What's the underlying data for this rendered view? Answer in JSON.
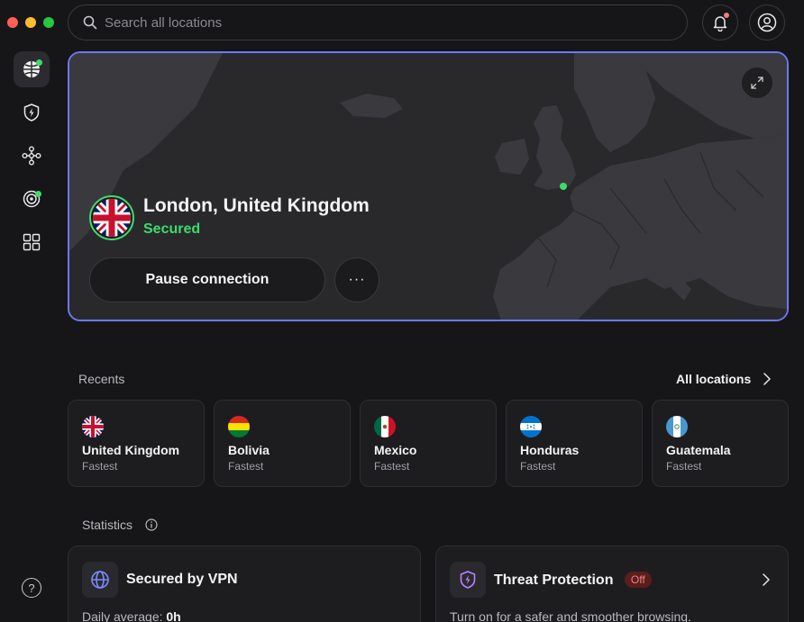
{
  "search": {
    "placeholder": "Search all locations"
  },
  "colors": {
    "accent": "#6a79f2",
    "connected": "#3ddc6a",
    "notification": "#f07f7f",
    "badge_off_bg": "#5c1d1d",
    "badge_off_text": "#f08080"
  },
  "connection": {
    "location": "London, United Kingdom",
    "status": "Secured",
    "pause_label": "Pause connection",
    "more_label": "···"
  },
  "recents": {
    "title": "Recents",
    "all_locations_label": "All locations",
    "items": [
      {
        "country": "United Kingdom",
        "mode": "Fastest",
        "flag": "uk"
      },
      {
        "country": "Bolivia",
        "mode": "Fastest",
        "flag": "bolivia"
      },
      {
        "country": "Mexico",
        "mode": "Fastest",
        "flag": "mexico"
      },
      {
        "country": "Honduras",
        "mode": "Fastest",
        "flag": "honduras"
      },
      {
        "country": "Guatemala",
        "mode": "Fastest",
        "flag": "guatemala"
      }
    ]
  },
  "statistics": {
    "title": "Statistics",
    "vpn_card": {
      "title": "Secured by VPN",
      "sub_label": "Daily average:",
      "sub_value": "0h"
    },
    "threat_card": {
      "title": "Threat Protection",
      "badge": "Off",
      "sub": "Turn on for a safer and smoother browsing."
    }
  },
  "sidebar": {
    "items": [
      {
        "icon": "globe-icon",
        "active": true
      },
      {
        "icon": "shield-bolt-icon",
        "active": false
      },
      {
        "icon": "mesh-network-icon",
        "active": false
      },
      {
        "icon": "target-icon",
        "active": false
      },
      {
        "icon": "grid-icon",
        "active": false
      }
    ],
    "help_label": "?"
  }
}
